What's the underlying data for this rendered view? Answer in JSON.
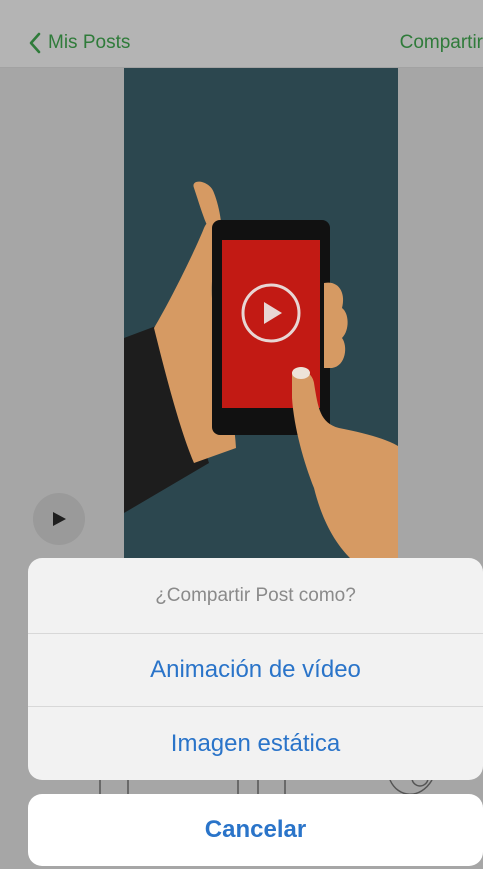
{
  "navbar": {
    "back_label": "Mis Posts",
    "share_label": "Compartir",
    "back_icon": "chevron-left-icon",
    "accent_color": "#2f7b3a"
  },
  "content": {
    "play_icon": "play-icon",
    "illustration": "hand-holding-phone-with-play-button"
  },
  "action_sheet": {
    "title": "¿Compartir Post como?",
    "options": [
      {
        "label": "Animación de vídeo"
      },
      {
        "label": "Imagen estática"
      }
    ],
    "cancel_label": "Cancelar",
    "action_color": "#2a74c9"
  }
}
